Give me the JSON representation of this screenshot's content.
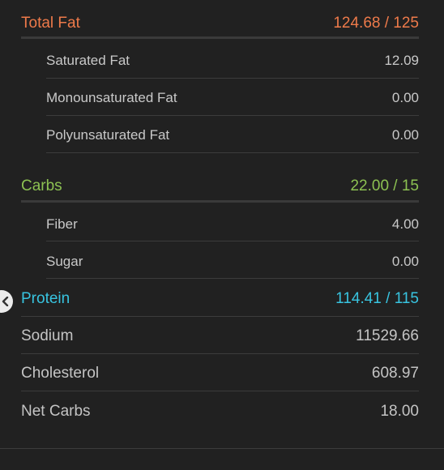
{
  "total_fat": {
    "label": "Total Fat",
    "value": "124.68 / 125",
    "color": "#ee7a4a"
  },
  "fat_items": [
    {
      "label": "Saturated Fat",
      "value": "12.09"
    },
    {
      "label": "Monounsaturated Fat",
      "value": "0.00"
    },
    {
      "label": "Polyunsaturated Fat",
      "value": "0.00"
    }
  ],
  "carbs": {
    "label": "Carbs",
    "value": "22.00 / 15",
    "color": "#8cc152"
  },
  "carb_items": [
    {
      "label": "Fiber",
      "value": "4.00"
    },
    {
      "label": "Sugar",
      "value": "0.00"
    }
  ],
  "protein": {
    "label": "Protein",
    "value": "114.41 / 115",
    "color": "#38c4e0"
  },
  "other": [
    {
      "label": "Sodium",
      "value": "11529.66"
    },
    {
      "label": "Cholesterol",
      "value": "608.97"
    },
    {
      "label": "Net Carbs",
      "value": "18.00"
    }
  ],
  "icons": {
    "collapse": "chevron-left-icon"
  }
}
